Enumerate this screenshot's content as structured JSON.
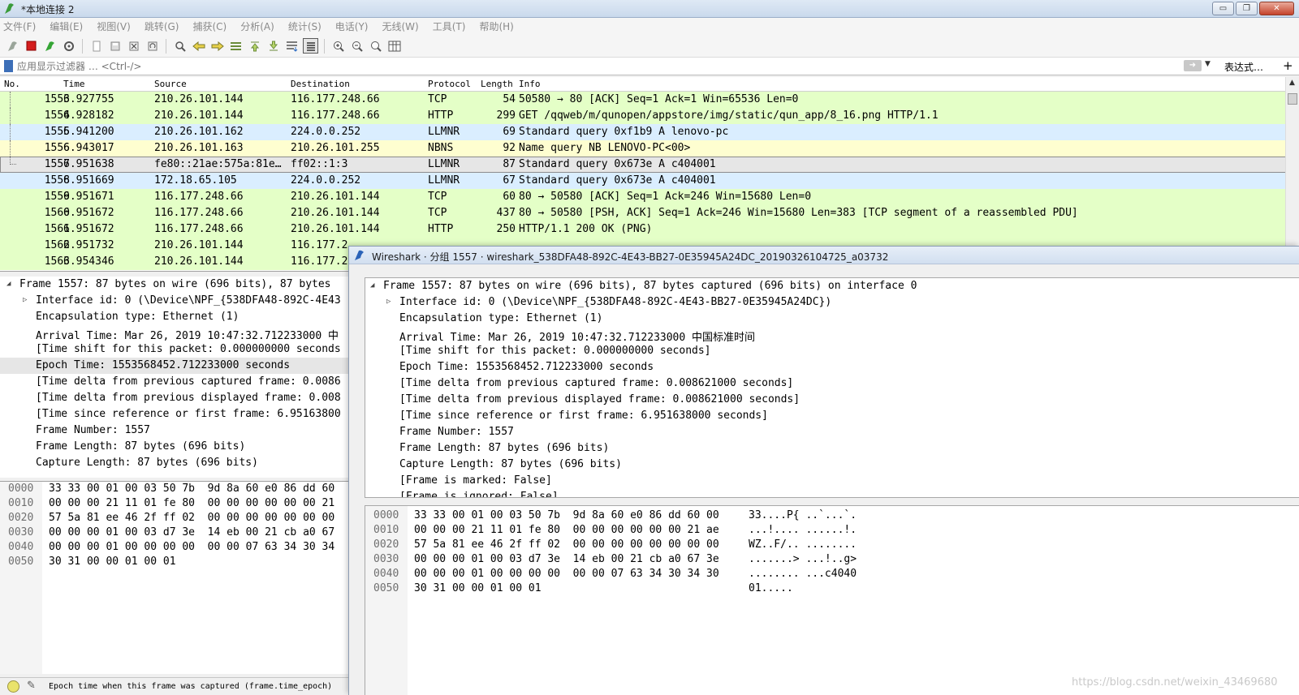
{
  "window": {
    "title": "*本地连接 2",
    "controls": {
      "minimize": "▭",
      "maximize": "❐",
      "close": "✕"
    }
  },
  "menu": [
    "文件(F)",
    "编辑(E)",
    "视图(V)",
    "跳转(G)",
    "捕获(C)",
    "分析(A)",
    "统计(S)",
    "电话(Y)",
    "无线(W)",
    "工具(T)",
    "帮助(H)"
  ],
  "toolbar": {
    "icons": [
      "fin-icon",
      "stop-icon",
      "restart-icon",
      "options-icon",
      "open-icon",
      "save-icon",
      "close-file-icon",
      "reload-icon",
      "find-icon",
      "back-icon",
      "forward-icon",
      "goto-icon",
      "first-icon",
      "last-icon",
      "autoscroll-icon",
      "colorize-icon",
      "zoom-in-icon",
      "zoom-out-icon",
      "zoom-reset-icon",
      "resize-columns-icon"
    ]
  },
  "filter": {
    "placeholder": "应用显示过滤器 … <Ctrl-/>",
    "expression_label": "表达式…",
    "add_label": "+"
  },
  "packet_list": {
    "columns": {
      "no": "No.",
      "time": "Time",
      "source": "Source",
      "destination": "Destination",
      "protocol": "Protocol",
      "length": "Length",
      "info": "Info"
    },
    "rows": [
      {
        "no": "1553",
        "time": "6.927755",
        "source": "210.26.101.144",
        "destination": "116.177.248.66",
        "protocol": "TCP",
        "length": "54",
        "info": "50580 → 80 [ACK] Seq=1 Ack=1 Win=65536 Len=0",
        "bg": "#e4ffc7"
      },
      {
        "no": "1554",
        "time": "6.928182",
        "source": "210.26.101.144",
        "destination": "116.177.248.66",
        "protocol": "HTTP",
        "length": "299",
        "info": "GET /qqweb/m/qunopen/appstore/img/static/qun_app/8_16.png HTTP/1.1",
        "bg": "#e4ffc7"
      },
      {
        "no": "1555",
        "time": "6.941200",
        "source": "210.26.101.162",
        "destination": "224.0.0.252",
        "protocol": "LLMNR",
        "length": "69",
        "info": "Standard query 0xf1b9 A lenovo-pc",
        "bg": "#daeeff"
      },
      {
        "no": "1556",
        "time": "6.943017",
        "source": "210.26.101.163",
        "destination": "210.26.101.255",
        "protocol": "NBNS",
        "length": "92",
        "info": "Name query NB LENOVO-PC<00>",
        "bg": "#fefed0"
      },
      {
        "no": "1557",
        "time": "6.951638",
        "source": "fe80::21ae:575a:81e…",
        "destination": "ff02::1:3",
        "protocol": "LLMNR",
        "length": "87",
        "info": "Standard query 0x673e A c404001",
        "bg": "#e6e6e6"
      },
      {
        "no": "1558",
        "time": "6.951669",
        "source": "172.18.65.105",
        "destination": "224.0.0.252",
        "protocol": "LLMNR",
        "length": "67",
        "info": "Standard query 0x673e A c404001",
        "bg": "#daeeff"
      },
      {
        "no": "1559",
        "time": "6.951671",
        "source": "116.177.248.66",
        "destination": "210.26.101.144",
        "protocol": "TCP",
        "length": "60",
        "info": "80 → 50580 [ACK] Seq=1 Ack=246 Win=15680 Len=0",
        "bg": "#e4ffc7"
      },
      {
        "no": "1560",
        "time": "6.951672",
        "source": "116.177.248.66",
        "destination": "210.26.101.144",
        "protocol": "TCP",
        "length": "437",
        "info": "80 → 50580 [PSH, ACK] Seq=1 Ack=246 Win=15680 Len=383 [TCP segment of a reassembled PDU]",
        "bg": "#e4ffc7"
      },
      {
        "no": "1561",
        "time": "6.951672",
        "source": "116.177.248.66",
        "destination": "210.26.101.144",
        "protocol": "HTTP",
        "length": "250",
        "info": "HTTP/1.1 200 OK  (PNG)",
        "bg": "#e4ffc7"
      },
      {
        "no": "1562",
        "time": "6.951732",
        "source": "210.26.101.144",
        "destination": "116.177.2",
        "protocol": "",
        "length": "",
        "info": "",
        "bg": "#e4ffc7"
      },
      {
        "no": "1563",
        "time": "6.954346",
        "source": "210.26.101.144",
        "destination": "116.177.2",
        "protocol": "",
        "length": "",
        "info": "",
        "bg": "#e4ffc7"
      }
    ]
  },
  "detail_left": [
    {
      "text": "Frame 1557: 87 bytes on wire (696 bits), 87 bytes",
      "indent": 0,
      "toggle": "◢"
    },
    {
      "text": "Interface id: 0 (\\Device\\NPF_{538DFA48-892C-4E43",
      "indent": 1,
      "toggle": "▷"
    },
    {
      "text": "Encapsulation type: Ethernet (1)",
      "indent": 1,
      "toggle": ""
    },
    {
      "text": "Arrival Time: Mar 26, 2019 10:47:32.712233000 中",
      "indent": 1,
      "toggle": ""
    },
    {
      "text": "[Time shift for this packet: 0.000000000 seconds",
      "indent": 1,
      "toggle": ""
    },
    {
      "text": "Epoch Time: 1553568452.712233000 seconds",
      "indent": 1,
      "toggle": "",
      "hl": true
    },
    {
      "text": "[Time delta from previous captured frame: 0.0086",
      "indent": 1,
      "toggle": ""
    },
    {
      "text": "[Time delta from previous displayed frame: 0.008",
      "indent": 1,
      "toggle": ""
    },
    {
      "text": "[Time since reference or first frame: 6.95163800",
      "indent": 1,
      "toggle": ""
    },
    {
      "text": "Frame Number: 1557",
      "indent": 1,
      "toggle": ""
    },
    {
      "text": "Frame Length: 87 bytes (696 bits)",
      "indent": 1,
      "toggle": ""
    },
    {
      "text": "Capture Length: 87 bytes (696 bits)",
      "indent": 1,
      "toggle": ""
    }
  ],
  "hex_left": [
    {
      "off": "0000",
      "hex": "33 33 00 01 00 03 50 7b  9d 8a 60 e0 86 dd 60"
    },
    {
      "off": "0010",
      "hex": "00 00 00 21 11 01 fe 80  00 00 00 00 00 00 21"
    },
    {
      "off": "0020",
      "hex": "57 5a 81 ee 46 2f ff 02  00 00 00 00 00 00 00"
    },
    {
      "off": "0030",
      "hex": "00 00 00 01 00 03 d7 3e  14 eb 00 21 cb a0 67"
    },
    {
      "off": "0040",
      "hex": "00 00 00 01 00 00 00 00  00 00 07 63 34 30 34"
    },
    {
      "off": "0050",
      "hex": "30 31 00 00 01 00 01"
    }
  ],
  "status": {
    "message": "Epoch time when this frame was captured (frame.time_epoch)"
  },
  "dialog": {
    "title": "Wireshark · 分组 1557 · wireshark_538DFA48-892C-4E43-BB27-0E35945A24DC_20190326104725_a03732",
    "detail": [
      {
        "text": "Frame 1557: 87 bytes on wire (696 bits), 87 bytes captured (696 bits) on interface 0",
        "indent": 0,
        "toggle": "◢"
      },
      {
        "text": "Interface id: 0 (\\Device\\NPF_{538DFA48-892C-4E43-BB27-0E35945A24DC})",
        "indent": 1,
        "toggle": "▷"
      },
      {
        "text": "Encapsulation type: Ethernet (1)",
        "indent": 1,
        "toggle": ""
      },
      {
        "text": "Arrival Time: Mar 26, 2019 10:47:32.712233000 中国标准时间",
        "indent": 1,
        "toggle": ""
      },
      {
        "text": "[Time shift for this packet: 0.000000000 seconds]",
        "indent": 1,
        "toggle": ""
      },
      {
        "text": "Epoch Time: 1553568452.712233000 seconds",
        "indent": 1,
        "toggle": ""
      },
      {
        "text": "[Time delta from previous captured frame: 0.008621000 seconds]",
        "indent": 1,
        "toggle": ""
      },
      {
        "text": "[Time delta from previous displayed frame: 0.008621000 seconds]",
        "indent": 1,
        "toggle": ""
      },
      {
        "text": "[Time since reference or first frame: 6.951638000 seconds]",
        "indent": 1,
        "toggle": ""
      },
      {
        "text": "Frame Number: 1557",
        "indent": 1,
        "toggle": ""
      },
      {
        "text": "Frame Length: 87 bytes (696 bits)",
        "indent": 1,
        "toggle": ""
      },
      {
        "text": "Capture Length: 87 bytes (696 bits)",
        "indent": 1,
        "toggle": ""
      },
      {
        "text": "[Frame is marked: False]",
        "indent": 1,
        "toggle": ""
      },
      {
        "text": "[Frame is ignored: False]",
        "indent": 1,
        "toggle": ""
      }
    ],
    "hex": [
      {
        "off": "0000",
        "hex": "33 33 00 01 00 03 50 7b  9d 8a 60 e0 86 dd 60 00",
        "asc": "33....P{ ..`...`."
      },
      {
        "off": "0010",
        "hex": "00 00 00 21 11 01 fe 80  00 00 00 00 00 00 21 ae",
        "asc": "...!.... ......!."
      },
      {
        "off": "0020",
        "hex": "57 5a 81 ee 46 2f ff 02  00 00 00 00 00 00 00 00",
        "asc": "WZ..F/.. ........"
      },
      {
        "off": "0030",
        "hex": "00 00 00 01 00 03 d7 3e  14 eb 00 21 cb a0 67 3e",
        "asc": ".......> ...!..g>"
      },
      {
        "off": "0040",
        "hex": "00 00 00 01 00 00 00 00  00 00 07 63 34 30 34 30",
        "asc": "........ ...c4040"
      },
      {
        "off": "0050",
        "hex": "30 31 00 00 01 00 01",
        "asc": "01....."
      }
    ]
  },
  "watermark": "https://blog.csdn.net/weixin_43469680"
}
